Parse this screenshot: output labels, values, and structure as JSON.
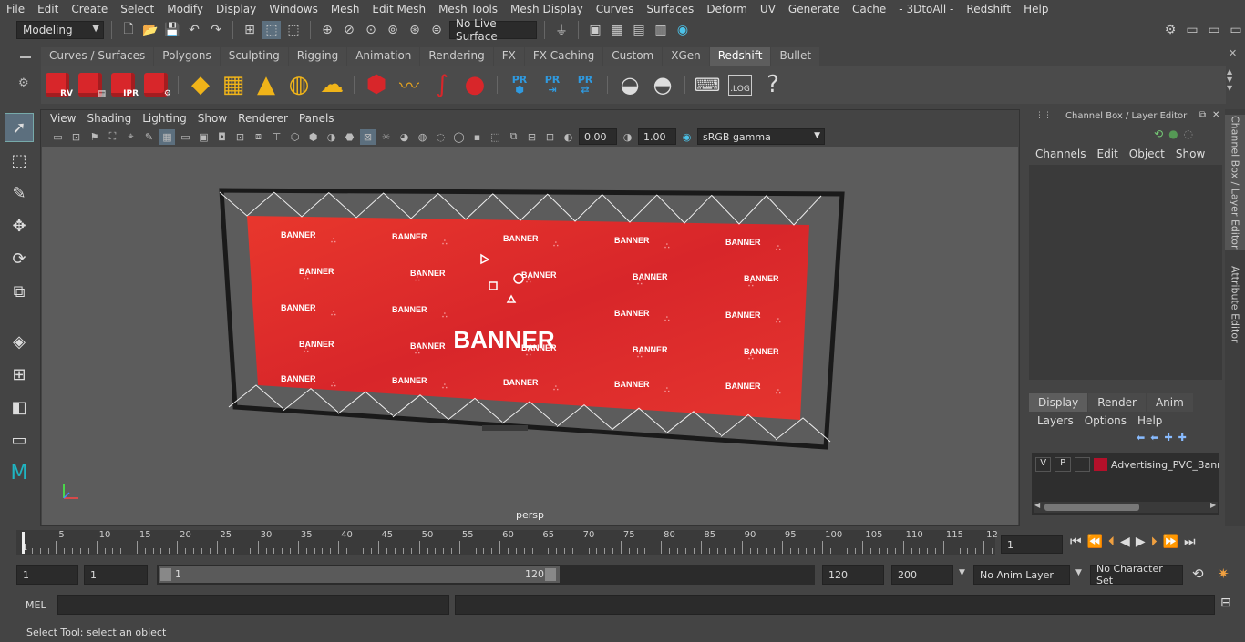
{
  "menu": [
    "File",
    "Edit",
    "Create",
    "Select",
    "Modify",
    "Display",
    "Windows",
    "Mesh",
    "Edit Mesh",
    "Mesh Tools",
    "Mesh Display",
    "Curves",
    "Surfaces",
    "Deform",
    "UV",
    "Generate",
    "Cache",
    "- 3DtoAll -",
    "Redshift",
    "Help"
  ],
  "status": {
    "mode": "Modeling",
    "live_surface": "No Live Surface"
  },
  "shelf_tabs": [
    "Curves / Surfaces",
    "Polygons",
    "Sculpting",
    "Rigging",
    "Animation",
    "Rendering",
    "FX",
    "FX Caching",
    "Custom",
    "XGen",
    "Redshift",
    "Bullet"
  ],
  "shelf_active": "Redshift",
  "shelf_labels": {
    "rv": "RV",
    "ipr": "IPR",
    "pr": "PR",
    "log": ".LOG",
    "help": "?"
  },
  "viewport": {
    "menu": [
      "View",
      "Shading",
      "Lighting",
      "Show",
      "Renderer",
      "Panels"
    ],
    "exposure": "0.00",
    "gamma": "1.00",
    "color_space": "sRGB gamma",
    "camera": "persp",
    "banner_big": "BANNER",
    "banner_small": "BANNER"
  },
  "channel_box": {
    "title": "Channel Box / Layer Editor",
    "menu": [
      "Channels",
      "Edit",
      "Object",
      "Show"
    ],
    "layer_tabs": [
      "Display",
      "Render",
      "Anim"
    ],
    "layer_tab_active": "Display",
    "layer_menu": [
      "Layers",
      "Options",
      "Help"
    ],
    "layer": {
      "v": "V",
      "p": "P",
      "name": "Advertising_PVC_Bann",
      "color": "#b3102a"
    }
  },
  "side_tabs": [
    "Channel Box / Layer Editor",
    "Attribute Editor"
  ],
  "timeline": {
    "ticks": [
      "5",
      "10",
      "15",
      "20",
      "25",
      "30",
      "35",
      "40",
      "45",
      "50",
      "55",
      "60",
      "65",
      "70",
      "75",
      "80",
      "85",
      "90",
      "95",
      "100",
      "105",
      "110",
      "115",
      "12"
    ],
    "start_tick": "1",
    "current_frame": "1"
  },
  "range": {
    "start": "1",
    "inner_start": "1",
    "slider_start": "1",
    "slider_end": "120",
    "end": "120",
    "total_end": "200",
    "anim_layer": "No Anim Layer",
    "char_set": "No Character Set"
  },
  "mel": {
    "label": "MEL"
  },
  "help_line": "Select Tool: select an object"
}
